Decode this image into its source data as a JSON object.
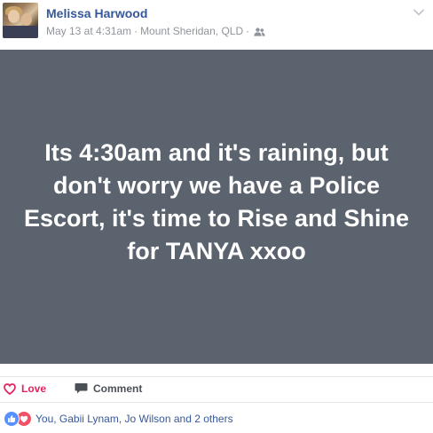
{
  "post": {
    "author": "Melissa Harwood",
    "date": "May 13 at 4:31am",
    "separator": "·",
    "location": "Mount Sheridan, QLD",
    "privacy_icon": "friends-icon",
    "menu_icon": "chevron-down-icon",
    "text": "Its 4:30am and it's raining, but don't worry we have a Police Escort, it's time to Rise and Shine for TANYA xxoo",
    "card_color": "#5b636e"
  },
  "actions": {
    "love_label": "Love",
    "love_icon": "heart-icon",
    "comment_label": "Comment",
    "comment_icon": "comment-icon"
  },
  "reactions": {
    "icons": [
      "like-icon",
      "love-icon"
    ],
    "summary": "You, Gabii Lynam, Jo Wilson and 2 others"
  },
  "colors": {
    "name": "#365899",
    "meta": "#90949c",
    "love": "#e0245e",
    "like_badge": "#5890ff",
    "love_badge": "#f25268"
  }
}
